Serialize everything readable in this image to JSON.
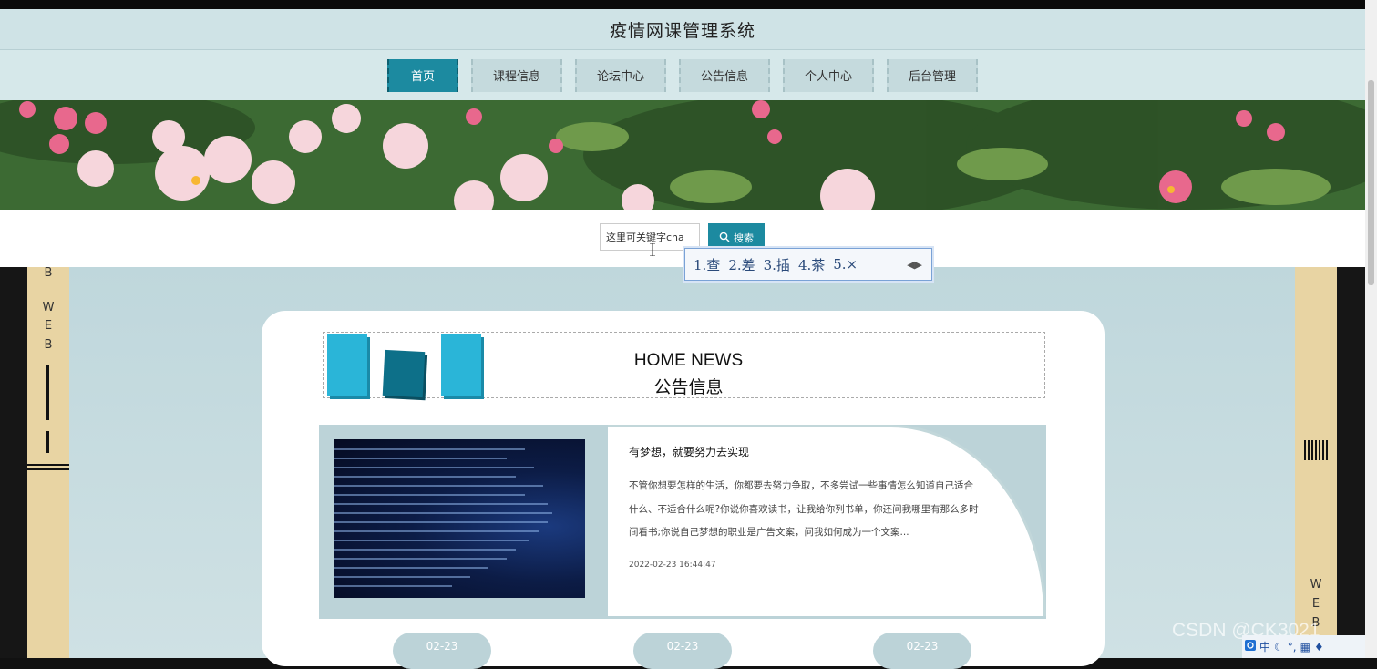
{
  "header": {
    "title": "疫情网课管理系统"
  },
  "nav": {
    "items": [
      {
        "label": "首页",
        "active": true
      },
      {
        "label": "课程信息",
        "active": false
      },
      {
        "label": "论坛中心",
        "active": false
      },
      {
        "label": "公告信息",
        "active": false
      },
      {
        "label": "个人中心",
        "active": false
      },
      {
        "label": "后台管理",
        "active": false
      }
    ]
  },
  "search": {
    "value": "这里可关键字cha",
    "button_label": "搜索"
  },
  "ime": {
    "candidates": [
      "1.查",
      "2.差",
      "3.插",
      "4.茶",
      "5.×"
    ]
  },
  "side_left": {
    "text": [
      "B",
      "W",
      "E",
      "B"
    ]
  },
  "side_right": {
    "text": [
      "W",
      "E",
      "B"
    ]
  },
  "news": {
    "title_en": "HOME NEWS",
    "title_zh": "公告信息",
    "featured": {
      "headline": "有梦想，就要努力去实现",
      "body": "不管你想要怎样的生活，你都要去努力争取，不多尝试一些事情怎么知道自己适合什么、不适合什么呢?你说你喜欢读书，让我给你列书单，你还问我哪里有那么多时间看书;你说自己梦想的职业是广告文案，问我如何成为一个文案...",
      "date": "2022-02-23 16:44:47"
    },
    "date_pills": [
      "02-23",
      "02-23",
      "02-23"
    ]
  },
  "watermark": "CSDN @CK3021",
  "tray": {
    "ime_label": "中"
  },
  "colors": {
    "accent": "#1c8aa0",
    "panel": "#bcd3d8",
    "side": "#e8d4a3"
  }
}
